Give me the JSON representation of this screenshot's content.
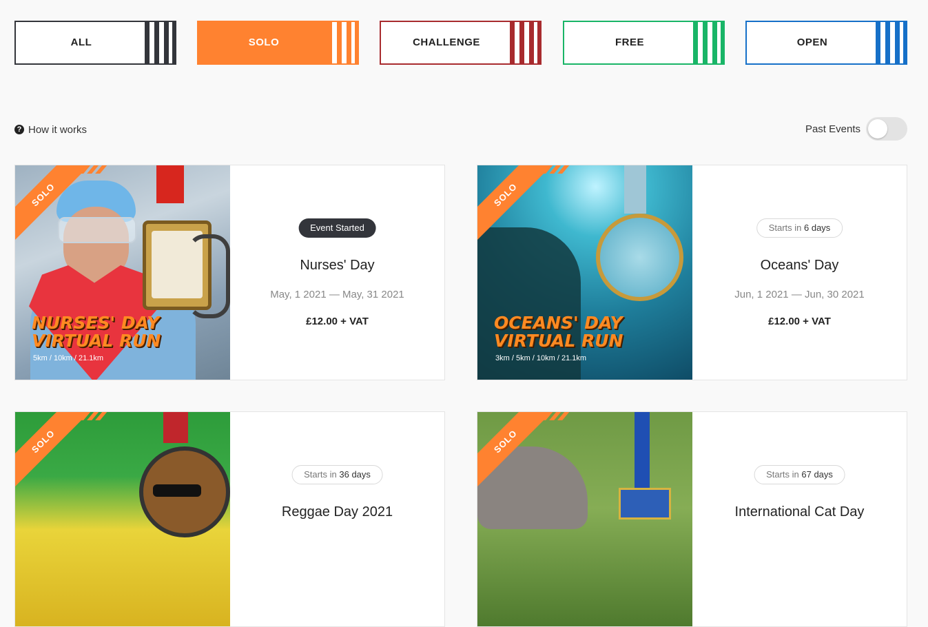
{
  "filters": [
    {
      "label": "ALL",
      "color": "#33353b",
      "active": false
    },
    {
      "label": "SOLO",
      "color": "#ff8230",
      "active": true
    },
    {
      "label": "CHALLENGE",
      "color": "#a82b2e",
      "active": false
    },
    {
      "label": "FREE",
      "color": "#19b567",
      "active": false
    },
    {
      "label": "OPEN",
      "color": "#1670c8",
      "active": false
    }
  ],
  "how_it_works": {
    "icon": "question-circle-icon",
    "label": "How it works"
  },
  "past_events": {
    "label": "Past Events",
    "enabled": false
  },
  "events": [
    {
      "ribbon": "SOLO",
      "art_title_line1": "NURSES' DAY",
      "art_title_line2": "VIRTUAL RUN",
      "art_distances": "5km / 10km / 21.1km",
      "status": "Event Started",
      "title": "Nurses' Day",
      "dates": "May, 1 2021 — May, 31 2021",
      "price": "£12.00 + VAT"
    },
    {
      "ribbon": "SOLO",
      "art_title_line1": "OCEANS' DAY",
      "art_title_line2": "VIRTUAL RUN",
      "art_distances": "3km / 5km / 10km / 21.1km",
      "status_prefix": "Starts in",
      "status_value": "6 days",
      "title": "Oceans' Day",
      "dates": "Jun, 1 2021 — Jun, 30 2021",
      "price": "£12.00 + VAT"
    },
    {
      "ribbon": "SOLO",
      "status_prefix": "Starts in",
      "status_value": "36 days",
      "title": "Reggae Day 2021"
    },
    {
      "ribbon": "SOLO",
      "status_prefix": "Starts in",
      "status_value": "67 days",
      "title": "International Cat Day"
    }
  ],
  "accent": "#ff8230"
}
